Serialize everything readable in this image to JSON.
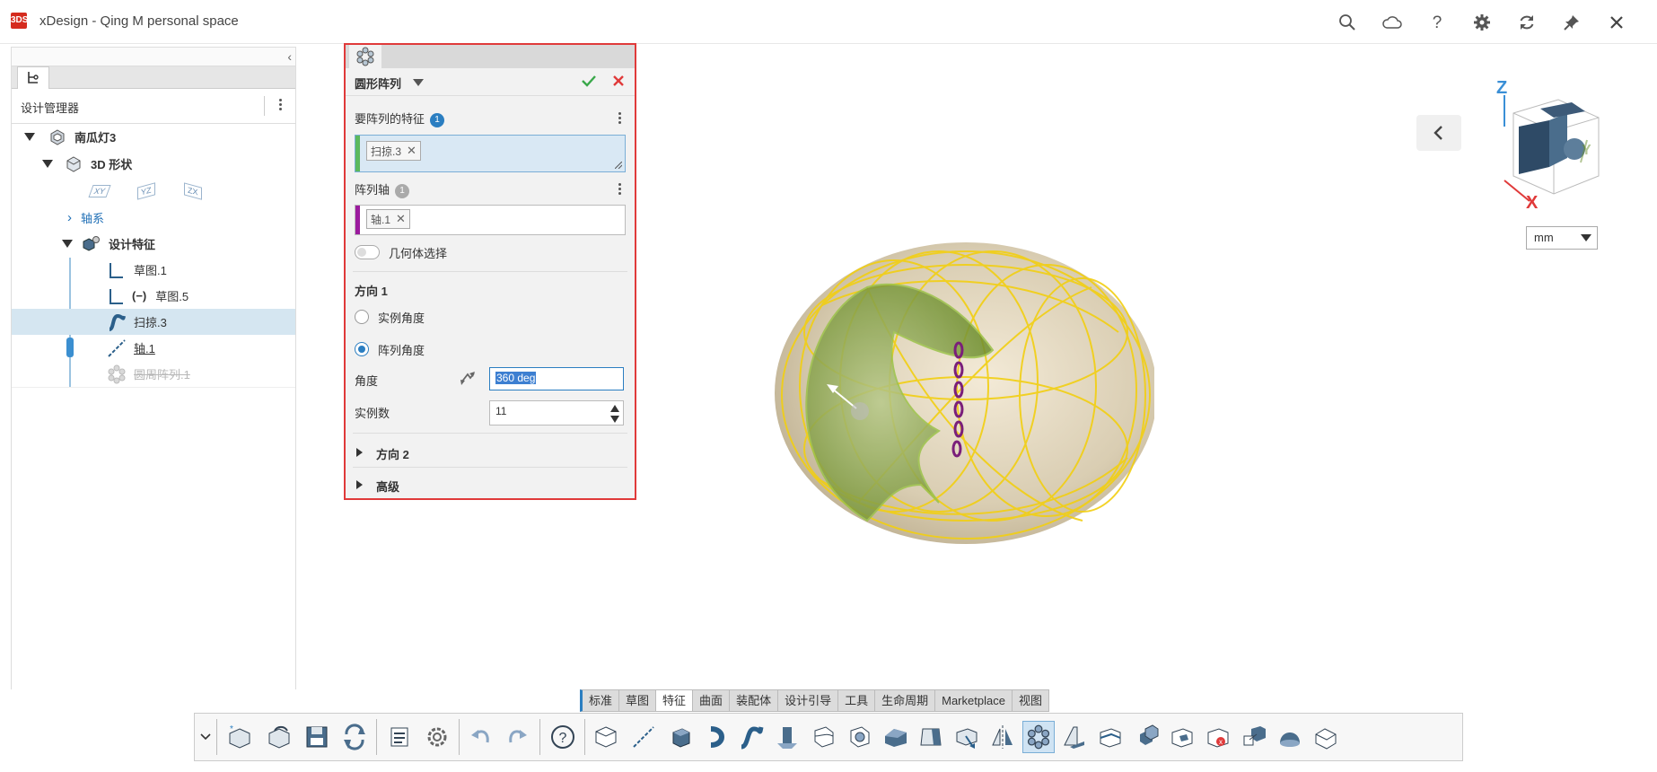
{
  "app": {
    "title": "xDesign - Qing M personal space",
    "logo_text": "3DS"
  },
  "left_panel": {
    "header": "设计管理器",
    "tree": [
      {
        "label": "南瓜灯3"
      },
      {
        "label": "3D 形状"
      },
      {
        "label": "轴系"
      },
      {
        "label": "设计特征"
      },
      {
        "label": "草图.1"
      },
      {
        "prefix": "(−)",
        "label": "草图.5"
      },
      {
        "label": "扫掠.3"
      },
      {
        "label": "轴.1"
      },
      {
        "label": "圆周阵列.1"
      }
    ],
    "planes": [
      "XY",
      "YZ",
      "ZX"
    ]
  },
  "property_manager": {
    "title": "圆形阵列",
    "features_label": "要阵列的特征",
    "features_count": "1",
    "features_chip": "扫掠.3",
    "axis_label": "阵列轴",
    "axis_count": "1",
    "axis_chip": "轴.1",
    "geometry_toggle_label": "几何体选择",
    "direction1": "方向 1",
    "radio_instance_angle": "实例角度",
    "radio_array_angle": "阵列角度",
    "angle_label": "角度",
    "angle_value": "360 deg",
    "instances_label": "实例数",
    "instances_value": "11",
    "direction2": "方向 2",
    "advanced": "高级"
  },
  "view": {
    "units": "mm",
    "axis_z": "Z",
    "axis_x": "X",
    "axis_y": "Y"
  },
  "command_tabs": [
    "标准",
    "草图",
    "特征",
    "曲面",
    "装配体",
    "设计引导",
    "工具",
    "生命周期",
    "Marketplace",
    "视图"
  ],
  "active_tab": "特征",
  "colors": {
    "accent": "#2b7ec1",
    "highlight_border": "#e03a3a",
    "sweep_green": "#7aaa3a",
    "pattern_yellow": "#f0cf10"
  }
}
